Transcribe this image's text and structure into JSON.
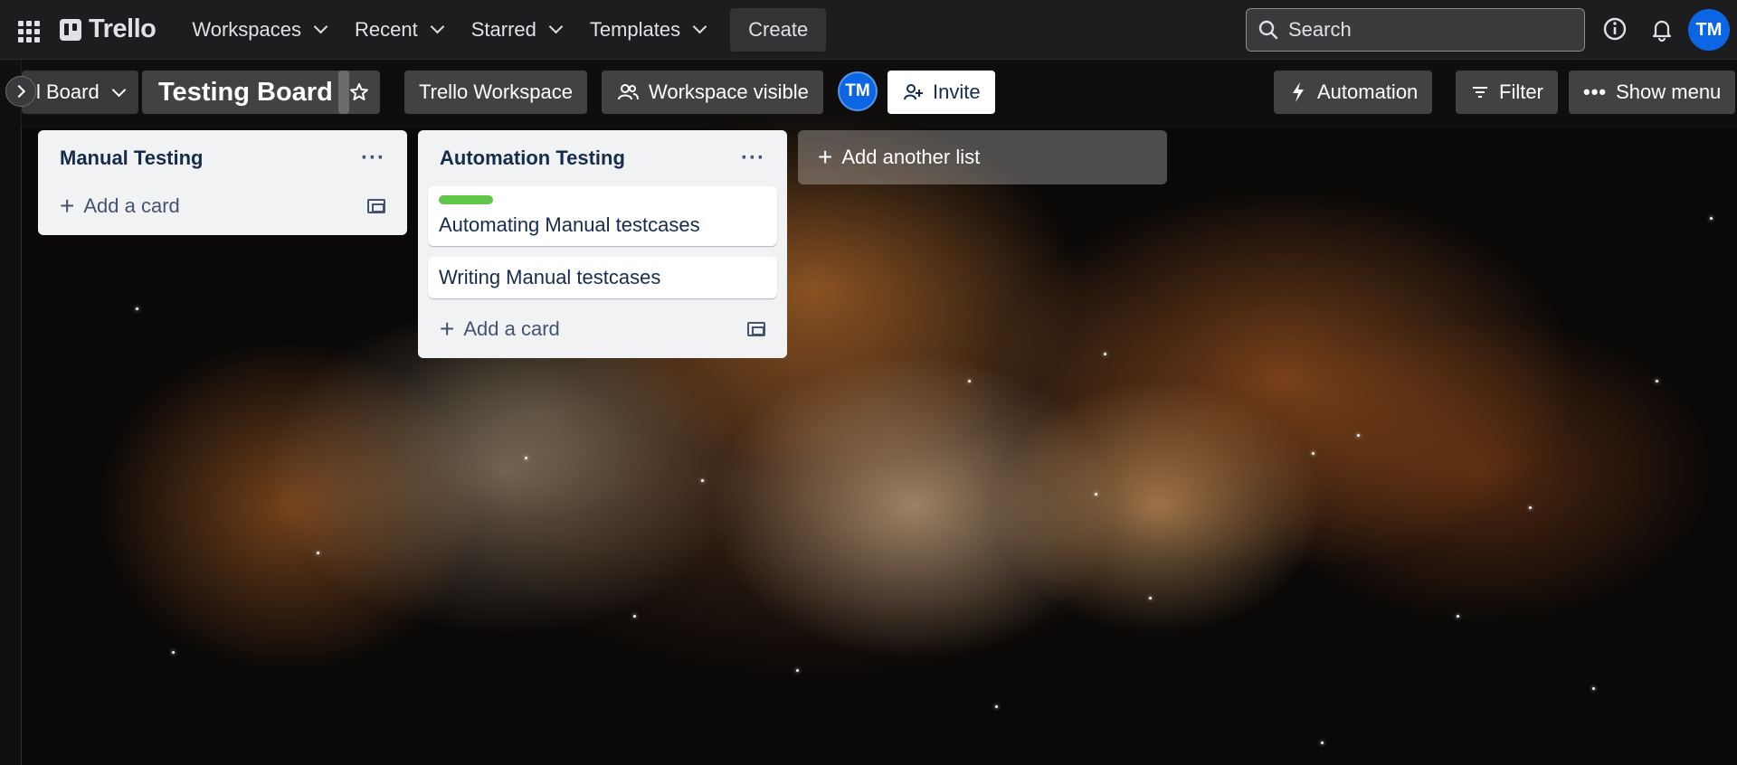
{
  "topnav": {
    "apps_icon": "grid-icon",
    "logo_text": "Trello",
    "items": [
      {
        "label": "Workspaces"
      },
      {
        "label": "Recent"
      },
      {
        "label": "Starred"
      },
      {
        "label": "Templates"
      }
    ],
    "create_label": "Create",
    "search": {
      "placeholder": "Search"
    },
    "avatar_initials": "TM"
  },
  "board_header": {
    "switcher_label": "l Board",
    "title": "Testing Board",
    "workspace_label": "Trello Workspace",
    "visibility_label": "Workspace visible",
    "member_initials": "TM",
    "invite_label": "Invite",
    "automation_label": "Automation",
    "filter_label": "Filter",
    "show_menu_label": "Show menu"
  },
  "lists": [
    {
      "title": "Manual Testing",
      "cards": [],
      "add_card_label": "Add a card"
    },
    {
      "title": "Automation Testing",
      "cards": [
        {
          "title": "Automating Manual testcases",
          "label_color": "#5fc649"
        },
        {
          "title": "Writing Manual testcases"
        }
      ],
      "add_card_label": "Add a card"
    }
  ],
  "add_list_label": "Add another list",
  "colors": {
    "topnav_bg": "#1d1d1f",
    "accent_blue": "#0c66e4",
    "list_bg": "#f1f2f4",
    "label_green": "#5fc649"
  }
}
